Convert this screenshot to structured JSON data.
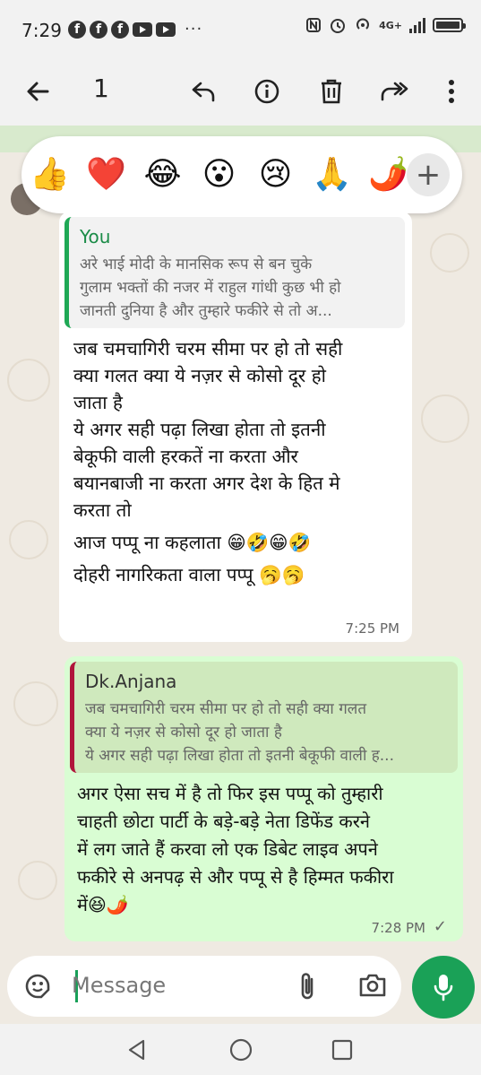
{
  "status_bar": {
    "time": "7:29",
    "more": "···",
    "network": "4G+"
  },
  "action_bar": {
    "selected_count": "1"
  },
  "reactions": [
    "👍",
    "❤️",
    "😂",
    "😮",
    "😢",
    "🙏",
    "🌶️"
  ],
  "incoming_message": {
    "quote_author": "You",
    "quote_lines": [
      "अरे भाई मोदी के मानसिक रूप से बन चुके",
      "गुलाम भक्तों की नजर में राहुल गांधी कुछ भी हो",
      "जानती दुनिया है और तुम्हारे फकीरे से तो अ..."
    ],
    "body_lines": [
      "जब चमचागिरी चरम सीमा पर हो तो सही",
      "क्या गलत क्या ये नज़र से कोसो दूर हो",
      "जाता है",
      "ये अगर सही पढ़ा लिखा होता तो इतनी",
      "बेकूफी वाली हरकतें ना करता और",
      "बयानबाजी ना करता अगर देश के हित मे",
      "करता तो",
      "आज पप्पू ना कहलाता 😁🤣😁🤣",
      "दोहरी नागरिकता वाला पप्पू 🥱🥱"
    ],
    "time": "7:25 PM"
  },
  "outgoing_message": {
    "quote_author": "Dk.Anjana",
    "quote_lines": [
      "जब चमचागिरी चरम सीमा पर हो तो सही क्या गलत",
      "क्या ये नज़र से कोसो दूर हो जाता है",
      "ये अगर सही पढ़ा लिखा होता तो इतनी बेकूफी वाली ह..."
    ],
    "body_lines": [
      "अगर ऐसा सच में है तो फिर इस पप्पू को तुम्हारी",
      "चाहती छोटा पार्टी के बड़े-बड़े नेता डिफेंड करने",
      "में लग जाते हैं करवा लो एक डिबेट लाइव अपने",
      "फकीरे से अनपढ़ से और पप्पू से है हिम्मत फकीरा",
      "में😆🌶️"
    ],
    "time": "7:28 PM",
    "status": "✓"
  },
  "composer": {
    "placeholder": "Message"
  },
  "colors": {
    "accent_green": "#1aa157",
    "outgoing_bubble": "#d9fdd3",
    "incoming_quote_bar": "#1fa855",
    "outgoing_quote_bar": "#b0143b"
  }
}
